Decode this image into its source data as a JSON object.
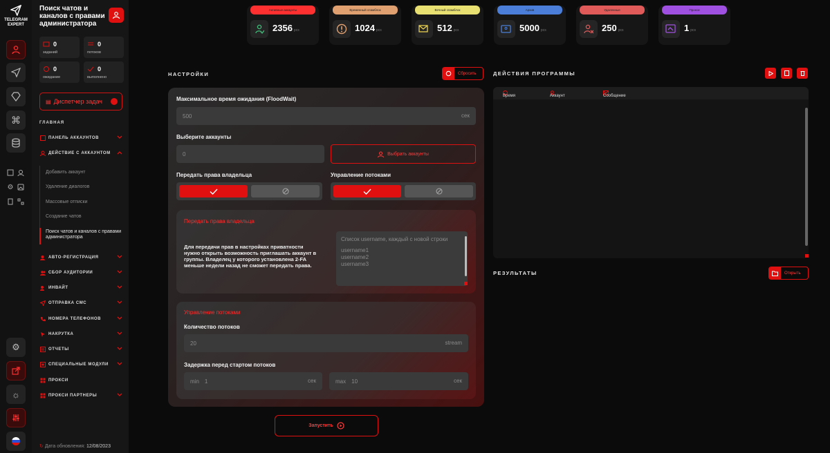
{
  "app": {
    "logo_line1": "TELEGRAM",
    "logo_line2": "EXPERT",
    "accent": "#e01010"
  },
  "sidebar": {
    "title": "Поиск чатов и каналов с правами администратора",
    "stats": [
      {
        "value": "0",
        "label": "заданий"
      },
      {
        "value": "0",
        "label": "потоков"
      },
      {
        "value": "0",
        "label": "ожидание"
      },
      {
        "value": "0",
        "label": "выполнено"
      }
    ],
    "dispatcher_label": "Диспетчер задач",
    "main_section": "ГЛАВНАЯ",
    "nav": [
      {
        "label": "ПАНЕЛЬ АККАУНТОВ"
      },
      {
        "label": "ДЕЙСТВИЕ С АККАУНТОМ"
      },
      {
        "label": "АВТО-РЕГИСТРАЦИЯ"
      },
      {
        "label": "СБОР АУДИТОРИИ"
      },
      {
        "label": "ИНВАЙТ"
      },
      {
        "label": "ОТПРАВКА СМС"
      },
      {
        "label": "НОМЕРА ТЕЛЕФОНОВ"
      },
      {
        "label": "НАКРУТКА"
      },
      {
        "label": "ОТЧЕТЫ"
      },
      {
        "label": "СПЕЦИАЛЬНЫЕ МОДУЛИ"
      },
      {
        "label": "ПРОКСИ"
      },
      {
        "label": "ПРОКСИ ПАРТНЕРЫ"
      }
    ],
    "subitems": [
      "Добавить аккаунт",
      "Удаление диалогов",
      "Массовые отписки",
      "Создание чатов",
      "Поиск чатов и каналов с правами администратора"
    ],
    "update_label": "Дата обновления:",
    "update_date": "12/08/2023"
  },
  "cards": [
    {
      "tag": "Активные аккаунты",
      "value": "2356",
      "unit": "pcs",
      "color": "#ff3030"
    },
    {
      "tag": "Временный спамблок",
      "value": "1024",
      "unit": "pcs",
      "color": "#e0a070"
    },
    {
      "tag": "Вечный спамблок",
      "value": "512",
      "unit": "pcs",
      "color": "#e8e070"
    },
    {
      "tag": "Архив",
      "value": "5000",
      "unit": "pcs",
      "color": "#4a7ed8"
    },
    {
      "tag": "Удаленные",
      "value": "250",
      "unit": "pcs",
      "color": "#e05a5a"
    },
    {
      "tag": "Прокси",
      "value": "1",
      "unit": "pcs",
      "color": "#a050e0"
    }
  ],
  "settings": {
    "header": "НАСТРОЙКИ",
    "reset": "Сбросить",
    "floodwait_label": "Максимальное время ожидания (FloodWait)",
    "floodwait_value": "500",
    "floodwait_unit": "сек",
    "accounts_label": "Выберите аккаунты",
    "accounts_value": "0",
    "select_accounts": "Выбрать аккаунты",
    "transfer_label": "Передать права владельца",
    "threads_label": "Управление потоками",
    "transfer_box": {
      "title": "Передать права владельца",
      "description": "Для передачи прав в настройках приватности нужно открыть возможность приглашать аккаунт в группы. Владелец у которого установлена 2-FA меньше недели назад не сможет передать права.",
      "placeholder": "Список username, каждый с новой строки",
      "usernames": "username1\nusername2\nusername3"
    },
    "threads_box": {
      "title": "Управление потоками",
      "count_label": "Количество потоков",
      "count_value": "20",
      "count_unit": "stream",
      "delay_label": "Задержка перед стартом потоков",
      "min_label": "min",
      "min_value": "1",
      "max_label": "max",
      "max_value": "10",
      "unit": "сек"
    },
    "launch": "Запустить"
  },
  "log": {
    "header": "ДЕЙСТВИЯ ПРОГРАММЫ",
    "columns": [
      "Время",
      "Аккаунт",
      "Сообщение"
    ]
  },
  "results": {
    "header": "РЕЗУЛЬТАТЫ",
    "open": "Открыть"
  }
}
